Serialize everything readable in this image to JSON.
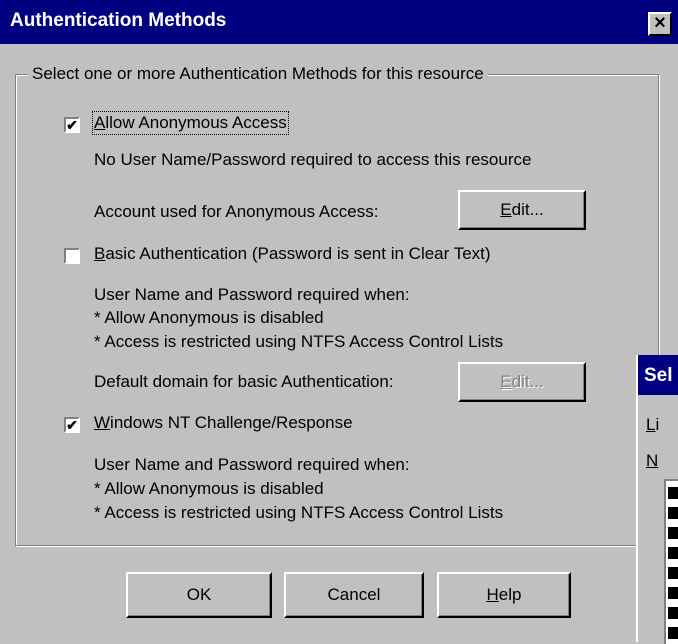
{
  "dialog": {
    "title": "Authentication Methods",
    "close_glyph": "×",
    "group_label": "Select one or more Authentication Methods for this resource",
    "anonymous": {
      "checked": true,
      "label_hotkey": "A",
      "label_rest": "llow Anonymous Access",
      "description": "No User Name/Password required to access this resource",
      "account_label": "Account used for Anonymous Access:",
      "edit_hotkey": "E",
      "edit_rest": "dit..."
    },
    "basic": {
      "checked": false,
      "label_hotkey": "B",
      "label_rest": "asic Authentication (Password is sent in Clear Text)",
      "line1": "User Name and Password required when:",
      "line2": "* Allow Anonymous is disabled",
      "line3": "* Access is restricted using NTFS Access Control Lists",
      "domain_label": "Default domain for basic Authentication:",
      "edit_hotkey": "E",
      "edit_rest": "dit..."
    },
    "ntlm": {
      "checked": true,
      "label_hotkey": "W",
      "label_rest": "indows NT Challenge/Response",
      "line1": "User Name and Password required when:",
      "line2": "* Allow Anonymous is disabled",
      "line3": "* Access is restricted using NTFS Access Control Lists"
    },
    "buttons": {
      "ok": "OK",
      "cancel": "Cancel",
      "help_hotkey": "H",
      "help_rest": "elp"
    }
  },
  "background_window": {
    "title_fragment": "Sel",
    "line1_hotkey": "L",
    "line1_rest": "i",
    "line2_hotkey": "N",
    "line2_rest": ""
  },
  "colors": {
    "face": "#c0c0c0",
    "titlebar": "#000080",
    "disabled_text": "#808080"
  }
}
